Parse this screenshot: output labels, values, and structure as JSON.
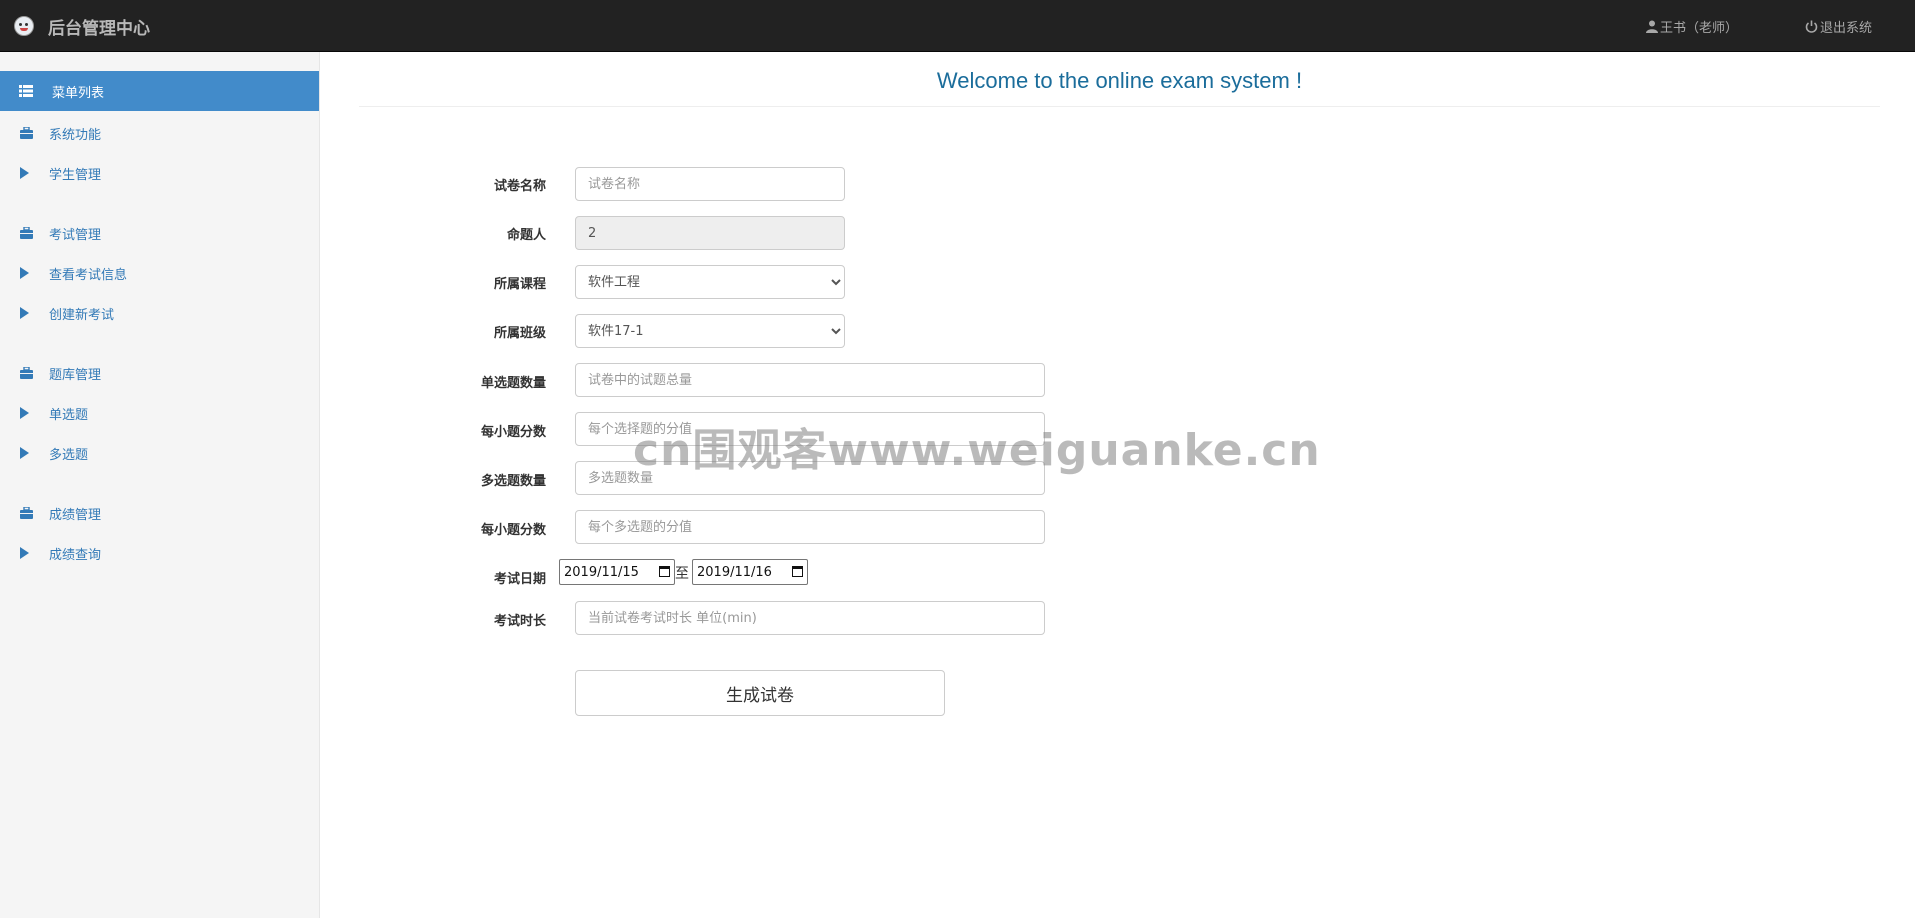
{
  "header": {
    "brand": "后台管理中心",
    "user": "王书（老师）",
    "logout": "退出系统"
  },
  "sidebar": {
    "header": "菜单列表",
    "groups": [
      {
        "title": "系统功能",
        "items": [
          "学生管理"
        ]
      },
      {
        "title": "考试管理",
        "items": [
          "查看考试信息",
          "创建新考试"
        ]
      },
      {
        "title": "题库管理",
        "items": [
          "单选题",
          "多选题"
        ]
      },
      {
        "title": "成绩管理",
        "items": [
          "成绩查询"
        ]
      }
    ]
  },
  "main": {
    "title": "Welcome to the online exam system !",
    "form": {
      "paper_name": {
        "label": "试卷名称",
        "placeholder": "试卷名称",
        "value": ""
      },
      "author": {
        "label": "命题人",
        "value": "2"
      },
      "course": {
        "label": "所属课程",
        "value": "软件工程"
      },
      "class": {
        "label": "所属班级",
        "value": "软件17-1"
      },
      "single_count": {
        "label": "单选题数量",
        "placeholder": "试卷中的试题总量"
      },
      "single_score": {
        "label": "每小题分数",
        "placeholder": "每个选择题的分值"
      },
      "multi_count": {
        "label": "多选题数量",
        "placeholder": "多选题数量"
      },
      "multi_score": {
        "label": "每小题分数",
        "placeholder": "每个多选题的分值"
      },
      "exam_date": {
        "label": "考试日期",
        "start": "2019/11/15",
        "separator": "至",
        "end": "2019/11/16"
      },
      "duration": {
        "label": "考试时长",
        "placeholder": "当前试卷考试时长 单位(min)"
      },
      "submit": "生成试卷"
    }
  },
  "watermark": "cn围观客www.weiguanke.cn"
}
